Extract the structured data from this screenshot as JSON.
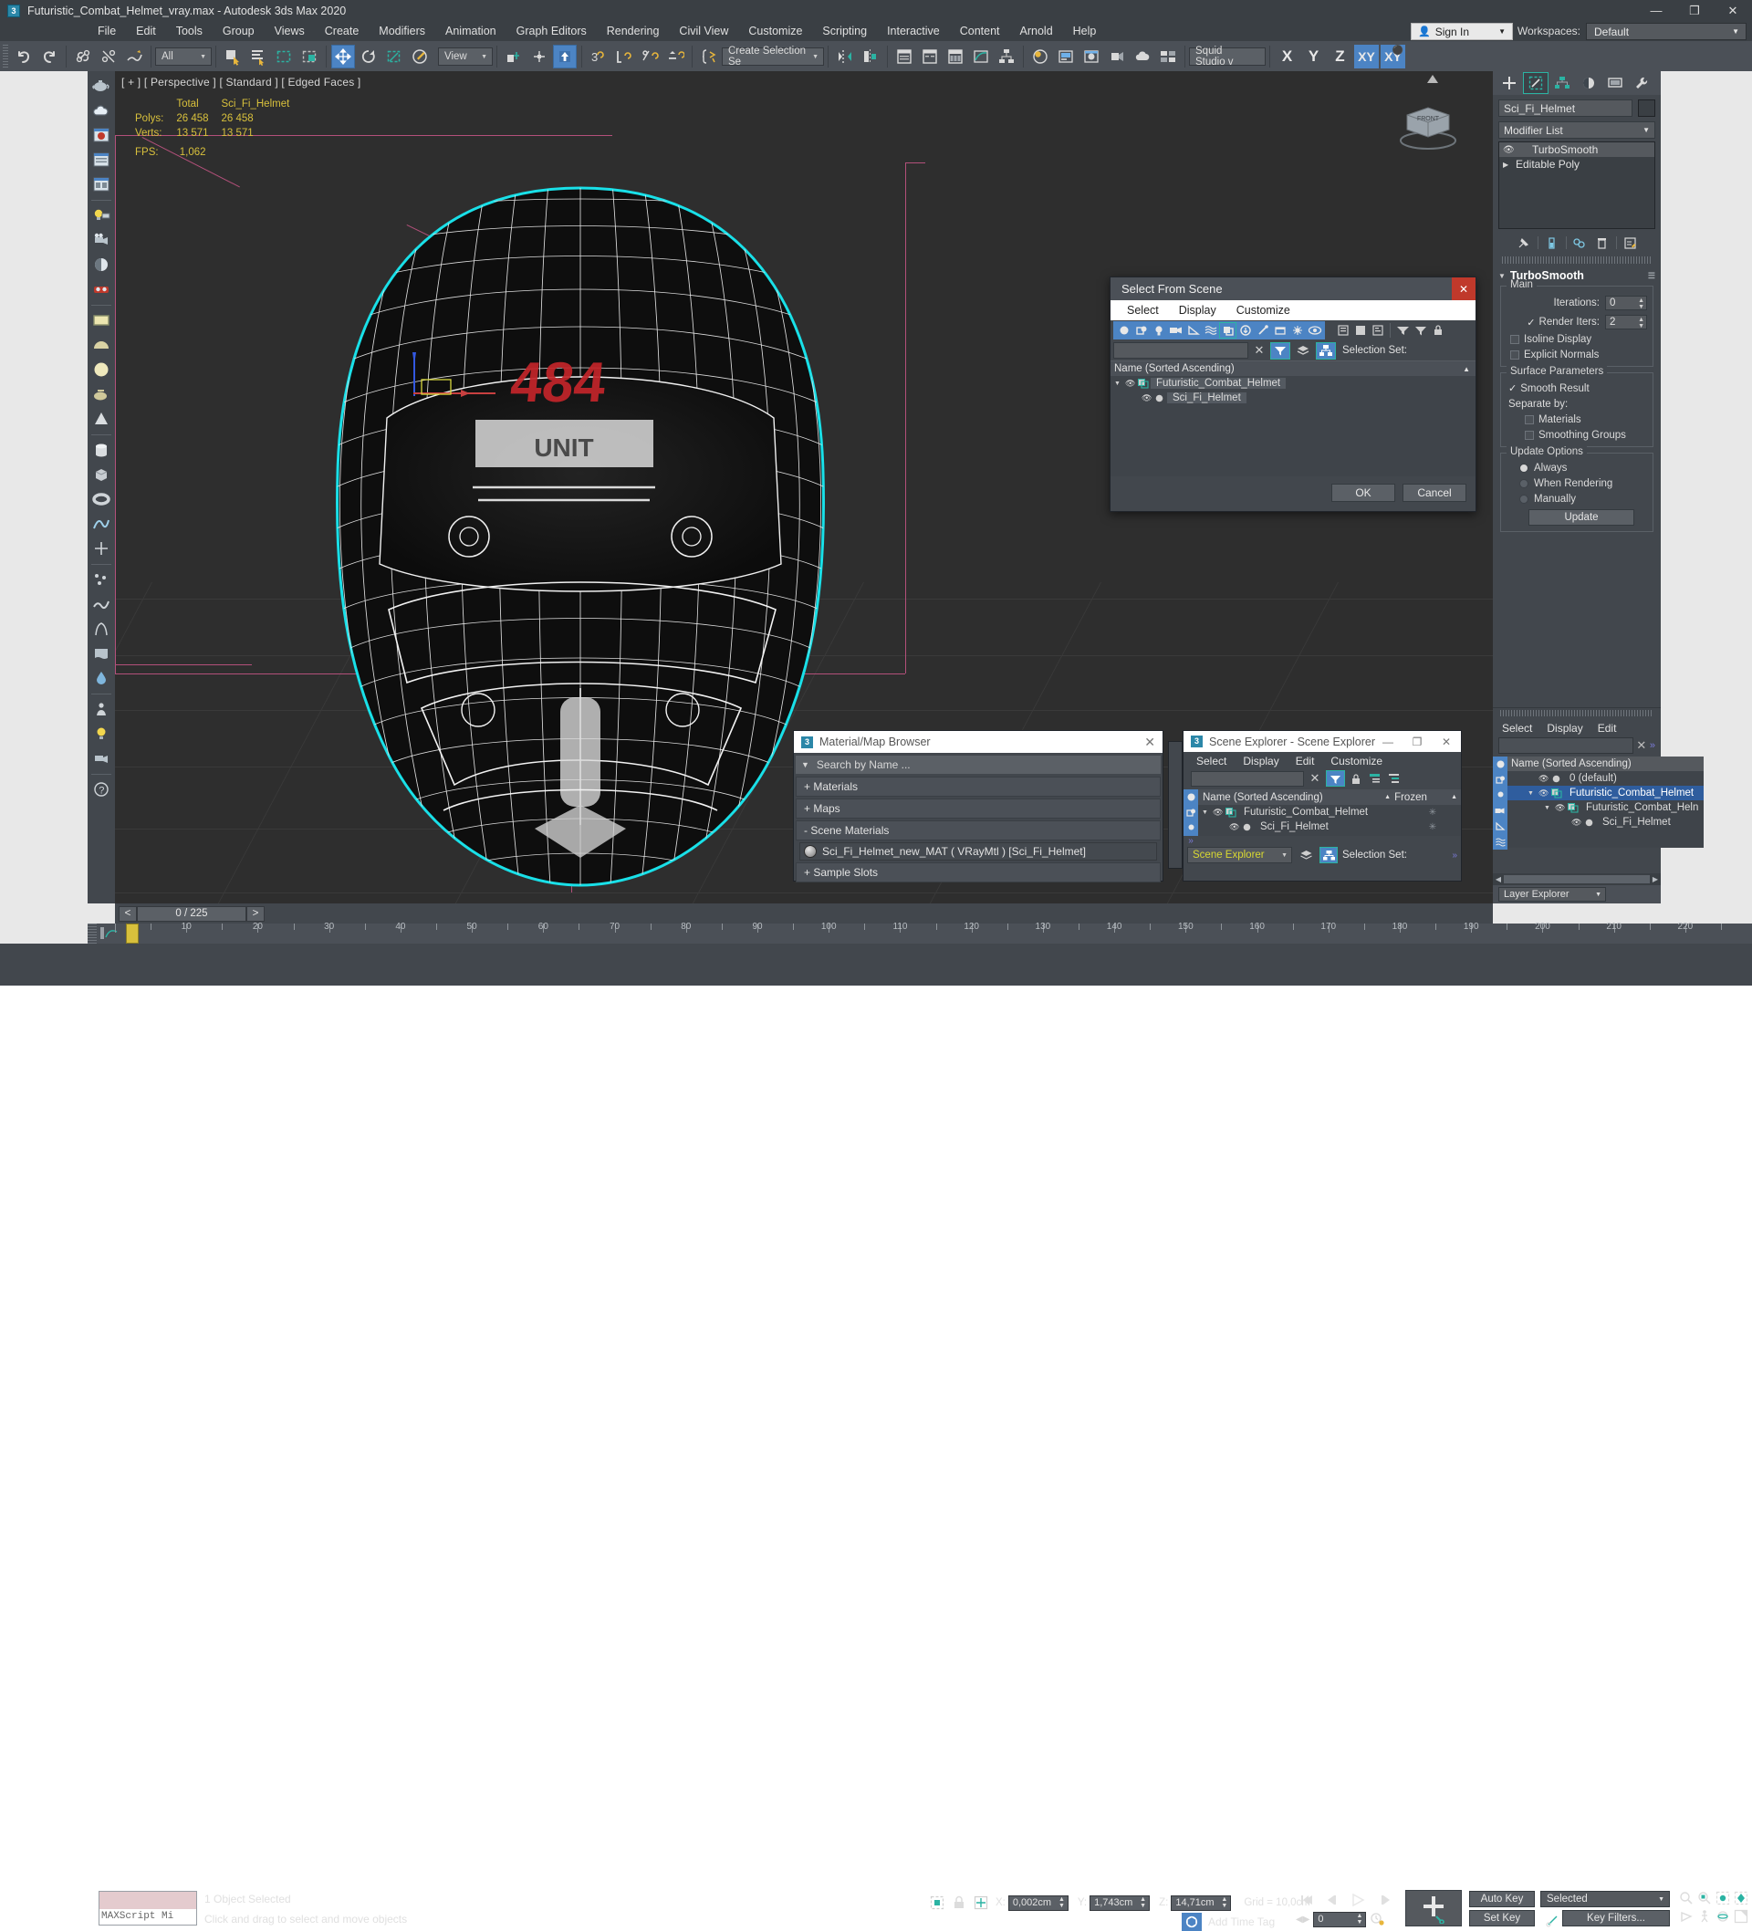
{
  "window": {
    "title": "Futuristic_Combat_Helmet_vray.max - Autodesk 3ds Max 2020",
    "app_badge": "3",
    "minimize": "—",
    "maximize": "❐",
    "close": "✕"
  },
  "menubar": {
    "items": [
      "File",
      "Edit",
      "Tools",
      "Group",
      "Views",
      "Create",
      "Modifiers",
      "Animation",
      "Graph Editors",
      "Rendering",
      "Civil View",
      "Customize",
      "Scripting",
      "Interactive",
      "Content",
      "Arnold",
      "Help"
    ],
    "sign_in": "Sign In",
    "workspaces_label": "Workspaces:",
    "workspace_value": "Default"
  },
  "toolbar": {
    "selection_filter": "All",
    "reference_coord": "View",
    "named_selection_sets": "Create Selection Se",
    "render_setup_preset": "Squid Studio v",
    "axis_buttons": [
      "X",
      "Y",
      "Z",
      "XY",
      "XY"
    ],
    "undo_icon": "undo-icon",
    "redo_icon": "redo-icon"
  },
  "viewport": {
    "label": "[ + ] [ Perspective ] [ Standard ] [ Edged Faces ]",
    "stats": {
      "col_total": "Total",
      "col_object": "Sci_Fi_Helmet",
      "rows": [
        {
          "label": "Polys:",
          "total": "26 458",
          "object": "26 458"
        },
        {
          "label": "Verts:",
          "total": "13 571",
          "object": "13 571"
        }
      ],
      "fps_label": "FPS:",
      "fps_value": "1,062"
    },
    "viewcube_face": "FRONT",
    "helmet_visor_text": "484",
    "helmet_band_text": "UNIT"
  },
  "command_panel": {
    "tabs": [
      "create-tab",
      "modify-tab",
      "hierarchy-tab",
      "motion-tab",
      "display-tab",
      "utilities-tab"
    ],
    "object_name": "Sci_Fi_Helmet",
    "modifier_list": "Modifier List",
    "stack": [
      {
        "name": "TurboSmooth",
        "selected": true
      },
      {
        "name": "Editable Poly",
        "selected": false
      }
    ],
    "rollout": {
      "title": "TurboSmooth",
      "main_group": "Main",
      "iterations_label": "Iterations:",
      "iterations_value": "0",
      "render_iters_label": "Render Iters:",
      "render_iters_value": "2",
      "render_iters_checked": true,
      "isoline_display": "Isoline Display",
      "explicit_normals": "Explicit Normals",
      "surface_group": "Surface Parameters",
      "smooth_result": "Smooth Result",
      "separate_by": "Separate by:",
      "materials": "Materials",
      "smoothing_groups": "Smoothing Groups",
      "update_group": "Update Options",
      "update_options": [
        "Always",
        "When Rendering",
        "Manually"
      ],
      "update_selected": "Always",
      "update_button": "Update"
    }
  },
  "layer_explorer": {
    "menus": [
      "Select",
      "Display",
      "Edit"
    ],
    "search_value": "",
    "column_header": "Name (Sorted Ascending)",
    "rows": [
      {
        "name": "0 (default)",
        "depth": 1,
        "selected": false
      },
      {
        "name": "Futuristic_Combat_Helmet",
        "depth": 1,
        "selected": true
      },
      {
        "name": "Futuristic_Combat_Heln",
        "depth": 2,
        "selected": false
      },
      {
        "name": "Sci_Fi_Helmet",
        "depth": 3,
        "selected": false
      }
    ],
    "footer_label": "Layer Explorer"
  },
  "select_from_scene": {
    "title": "Select From Scene",
    "menus": [
      "Select",
      "Display",
      "Customize"
    ],
    "search_value": "",
    "selection_set_label": "Selection Set:",
    "column_header": "Name (Sorted Ascending)",
    "rows": [
      {
        "name": "Futuristic_Combat_Helmet",
        "depth": 0,
        "highlight": true
      },
      {
        "name": "Sci_Fi_Helmet",
        "depth": 1,
        "highlight": true
      }
    ],
    "ok": "OK",
    "cancel": "Cancel",
    "close": "✕",
    "filter_icons": [
      "geometry-filter-icon",
      "shapes-filter-icon",
      "lights-filter-icon",
      "cameras-filter-icon",
      "helpers-filter-icon",
      "space-warps-filter-icon",
      "groups-filter-icon",
      "xrefs-filter-icon",
      "bones-filter-icon",
      "containers-filter-icon",
      "particles-filter-icon",
      "visibility-filter-icon"
    ]
  },
  "material_browser": {
    "title": "Material/Map Browser",
    "badge": "3",
    "close": "✕",
    "search_placeholder": "Search by Name ...",
    "sections": [
      {
        "label": "+ Materials",
        "expanded": false
      },
      {
        "label": "+ Maps",
        "expanded": false
      },
      {
        "label": "- Scene Materials",
        "expanded": true
      },
      {
        "label": "+ Sample Slots",
        "expanded": false
      }
    ],
    "scene_material": "Sci_Fi_Helmet_new_MAT  ( VRayMtl )  [Sci_Fi_Helmet]"
  },
  "scene_explorer": {
    "title": "Scene Explorer - Scene Explorer",
    "badge": "3",
    "minimize": "—",
    "maximize": "❐",
    "close": "✕",
    "menus": [
      "Select",
      "Display",
      "Edit",
      "Customize"
    ],
    "search_value": "",
    "columns": [
      "Name (Sorted Ascending)",
      "Frozen"
    ],
    "rows": [
      {
        "name": "Futuristic_Combat_Helmet",
        "depth": 0,
        "frozen": "✳"
      },
      {
        "name": "Sci_Fi_Helmet",
        "depth": 1,
        "frozen": "✳"
      }
    ],
    "explorer_combo": "Scene Explorer",
    "selection_set_label": "Selection Set:"
  },
  "timeline": {
    "frame_display": "0 / 225",
    "prev_arrow": "<",
    "next_arrow": ">",
    "ticks": [
      "10",
      "20",
      "30",
      "40",
      "50",
      "60",
      "70",
      "80",
      "90",
      "100",
      "110",
      "120",
      "130",
      "140",
      "150",
      "160",
      "170",
      "180",
      "190",
      "200",
      "210",
      "220"
    ]
  },
  "statusbar": {
    "maxscript_mini_listener": "MAXScript Mi",
    "selection_status": "1 Object Selected",
    "prompt": "Click and drag to select and move objects",
    "coords": [
      {
        "axis": "X:",
        "value": "0,002cm"
      },
      {
        "axis": "Y:",
        "value": "1,743cm"
      },
      {
        "axis": "Z:",
        "value": "14,71cm"
      }
    ],
    "grid": "Grid = 10,0cm",
    "add_time_tag": "Add Time Tag",
    "current_frame": "0",
    "auto_key": "Auto Key",
    "set_key": "Set Key",
    "key_mode": "Selected",
    "key_filters": "Key Filters..."
  },
  "colors": {
    "accent_blue": "#4c84c4",
    "teal": "#2bb3a3",
    "panel": "#42474d",
    "toolbar": "#4b5057",
    "stat_yellow": "#d8c03c",
    "pink_guide": "#b3507a",
    "viewport_bg": "#2e2e2e",
    "selected_row": "#2f5d9e",
    "close_red": "#c0392b"
  }
}
